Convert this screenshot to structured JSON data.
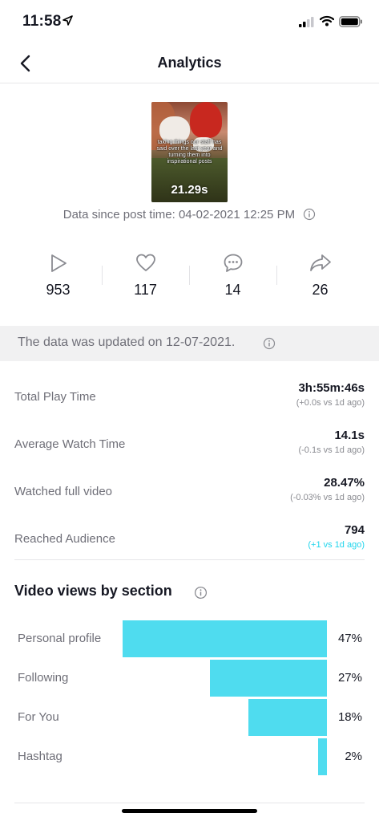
{
  "status_bar": {
    "time": "11:58"
  },
  "nav": {
    "title": "Analytics"
  },
  "video": {
    "caption": "taking things our staff has said over the last year and turning them into inspirational posts",
    "duration": "21.29s"
  },
  "data_since": "Data since post time: 04-02-2021 12:25 PM",
  "stats": [
    {
      "icon": "play-icon",
      "value": "953"
    },
    {
      "icon": "heart-icon",
      "value": "117"
    },
    {
      "icon": "comment-icon",
      "value": "14"
    },
    {
      "icon": "share-icon",
      "value": "26"
    }
  ],
  "updated_notice": "The data was updated on 12-07-2021.",
  "metrics": [
    {
      "label": "Total Play Time",
      "value": "3h:55m:46s",
      "delta": "(+0.0s vs 1d ago)",
      "delta_color": "#8a8b91"
    },
    {
      "label": "Average Watch Time",
      "value": "14.1s",
      "delta": "(-0.1s vs 1d ago)",
      "delta_color": "#8a8b91"
    },
    {
      "label": "Watched full video",
      "value": "28.47%",
      "delta": "(-0.03% vs 1d ago)",
      "delta_color": "#8a8b91"
    },
    {
      "label": "Reached Audience",
      "value": "794",
      "delta": "(+1 vs 1d ago)",
      "delta_color": "#20d5ec"
    }
  ],
  "views_section": {
    "title": "Video views by section",
    "bar_color": "#4fdcef",
    "rows": [
      {
        "label": "Personal profile",
        "percent_label": "47%",
        "percent": 47
      },
      {
        "label": "Following",
        "percent_label": "27%",
        "percent": 27
      },
      {
        "label": "For You",
        "percent_label": "18%",
        "percent": 18
      },
      {
        "label": "Hashtag",
        "percent_label": "2%",
        "percent": 2
      }
    ]
  }
}
